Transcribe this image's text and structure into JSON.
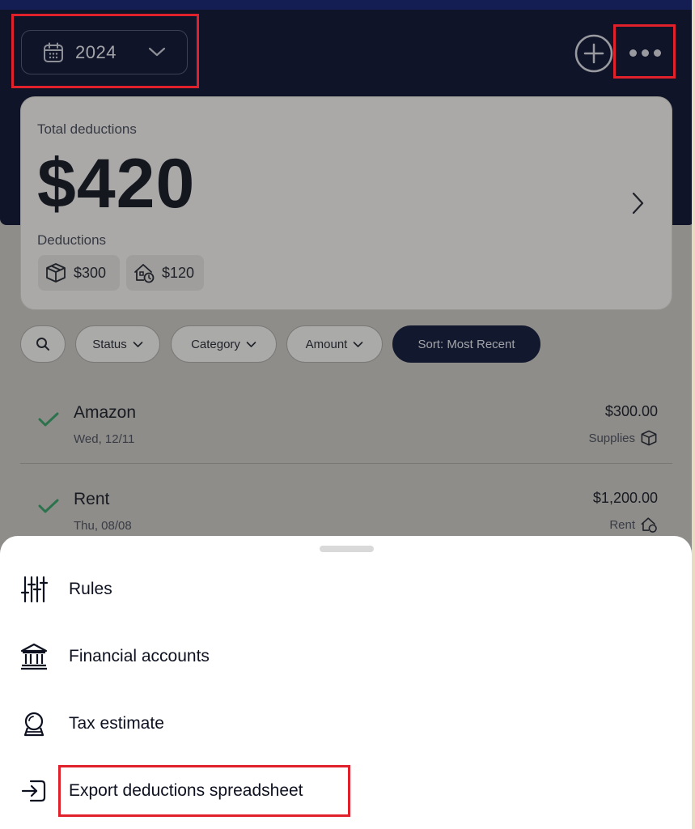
{
  "header": {
    "year": "2024"
  },
  "summary": {
    "total_label": "Total deductions",
    "total_amount": "$420",
    "deductions_label": "Deductions",
    "chips": [
      {
        "icon": "box-icon",
        "value": "$300"
      },
      {
        "icon": "home-office-icon",
        "value": "$120"
      }
    ]
  },
  "filters": {
    "status": "Status",
    "category": "Category",
    "amount": "Amount",
    "sort": "Sort: Most Recent"
  },
  "transactions": [
    {
      "name": "Amazon",
      "date": "Wed, 12/11",
      "amount": "$300.00",
      "category": "Supplies",
      "category_icon": "box-icon"
    },
    {
      "name": "Rent",
      "date": "Thu, 08/08",
      "amount": "$1,200.00",
      "category": "Rent",
      "category_icon": "home-office-icon"
    }
  ],
  "menu": {
    "items": [
      {
        "label": "Rules",
        "icon": "sliders-icon"
      },
      {
        "label": "Financial accounts",
        "icon": "bank-icon"
      },
      {
        "label": "Tax estimate",
        "icon": "crystal-ball-icon"
      },
      {
        "label": "Export deductions spreadsheet",
        "icon": "export-icon"
      }
    ]
  },
  "colors": {
    "header_bg": "#020a2a",
    "sort_pill": "#071133",
    "check_green": "#2f9e63",
    "highlight_red": "#e0202a"
  }
}
